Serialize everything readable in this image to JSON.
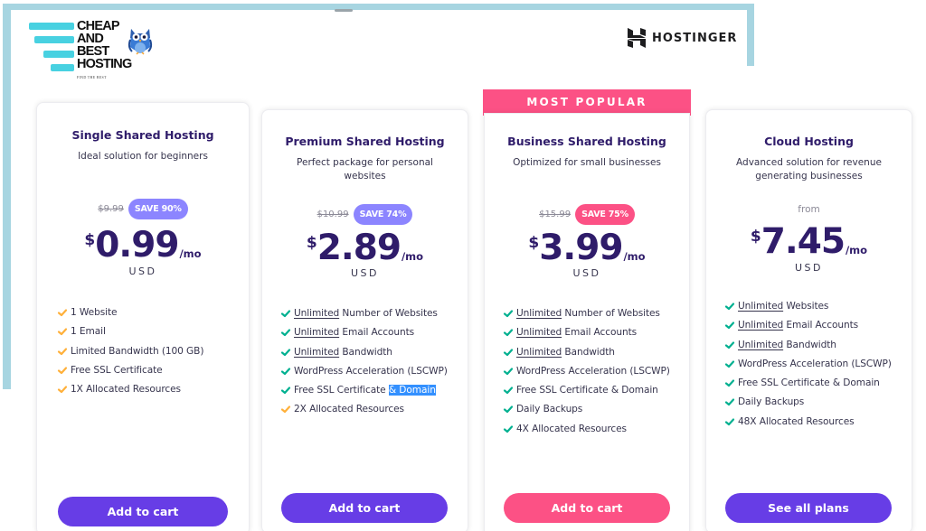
{
  "logo": {
    "lines": [
      "CHEAP",
      "AND",
      "BEST",
      "HOSTING"
    ],
    "tagline": "FIND THE BEST",
    "icon": "owl-icon"
  },
  "brand": {
    "name": "HOSTINGER",
    "icon": "hostinger-logo-icon"
  },
  "colors": {
    "frame": "#a7d5e1",
    "primary": "#673de6",
    "accent_pink": "#fc5185",
    "save_purple": "#8c85ff",
    "heading": "#2f1c6a",
    "check_green": "#00b090",
    "check_orange": "#ffb03a",
    "selection": "#3390ff"
  },
  "badge": "MOST POPULAR",
  "plans": [
    {
      "title": "Single Shared Hosting",
      "description": "Ideal solution for beginners",
      "old_price": "$9.99",
      "save": "SAVE 90%",
      "from": "",
      "currency_symbol": "$",
      "price": "0.99",
      "period": "/mo",
      "currency": "USD",
      "features": [
        {
          "underlined": "",
          "text": "1 Website",
          "check": "orange"
        },
        {
          "underlined": "",
          "text": "1 Email",
          "check": "orange"
        },
        {
          "underlined": "",
          "text": "Limited Bandwidth (100 GB)",
          "check": "orange"
        },
        {
          "underlined": "",
          "text": "Free SSL Certificate",
          "check": "orange"
        },
        {
          "underlined": "",
          "text": "1X Allocated Resources",
          "check": "orange"
        }
      ],
      "button": "Add to cart"
    },
    {
      "title": "Premium Shared Hosting",
      "description": "Perfect package for personal websites",
      "old_price": "$10.99",
      "save": "SAVE 74%",
      "from": "",
      "currency_symbol": "$",
      "price": "2.89",
      "period": "/mo",
      "currency": "USD",
      "features": [
        {
          "underlined": "Unlimited",
          "text": " Number of Websites",
          "check": "green"
        },
        {
          "underlined": "Unlimited",
          "text": " Email Accounts",
          "check": "green"
        },
        {
          "underlined": "Unlimited",
          "text": " Bandwidth",
          "check": "green"
        },
        {
          "underlined": "",
          "text": "WordPress Acceleration (LSCWP)",
          "check": "green"
        },
        {
          "underlined": "",
          "text": "Free SSL Certificate ",
          "highlighted": "& Domain",
          "check": "green"
        },
        {
          "underlined": "",
          "text": "2X Allocated Resources",
          "check": "orange"
        }
      ],
      "button": "Add to cart"
    },
    {
      "title": "Business Shared Hosting",
      "description": "Optimized for small businesses",
      "old_price": "$15.99",
      "save": "SAVE 75%",
      "from": "",
      "currency_symbol": "$",
      "price": "3.99",
      "period": "/mo",
      "currency": "USD",
      "features": [
        {
          "underlined": "Unlimited",
          "text": " Number of Websites",
          "check": "green"
        },
        {
          "underlined": "Unlimited",
          "text": " Email Accounts",
          "check": "green"
        },
        {
          "underlined": "Unlimited",
          "text": " Bandwidth",
          "check": "green"
        },
        {
          "underlined": "",
          "text": "WordPress Acceleration (LSCWP)",
          "check": "green"
        },
        {
          "underlined": "",
          "text": "Free SSL Certificate & Domain",
          "check": "green"
        },
        {
          "underlined": "",
          "text": "Daily Backups",
          "check": "green"
        },
        {
          "underlined": "",
          "text": "4X Allocated Resources",
          "check": "green"
        }
      ],
      "button": "Add to cart"
    },
    {
      "title": "Cloud Hosting",
      "description": "Advanced solution for revenue generating businesses",
      "old_price": "",
      "save": "",
      "from": "from",
      "currency_symbol": "$",
      "price": "7.45",
      "period": "/mo",
      "currency": "USD",
      "features": [
        {
          "underlined": "Unlimited",
          "text": " Websites",
          "check": "green"
        },
        {
          "underlined": "Unlimited",
          "text": " Email Accounts",
          "check": "green"
        },
        {
          "underlined": "Unlimited",
          "text": " Bandwidth",
          "check": "green"
        },
        {
          "underlined": "",
          "text": "WordPress Acceleration (LSCWP)",
          "check": "green"
        },
        {
          "underlined": "",
          "text": "Free SSL Certificate & Domain",
          "check": "green"
        },
        {
          "underlined": "",
          "text": "Daily Backups",
          "check": "green"
        },
        {
          "underlined": "",
          "text": "48X Allocated Resources",
          "check": "green"
        }
      ],
      "button": "See all plans"
    }
  ]
}
